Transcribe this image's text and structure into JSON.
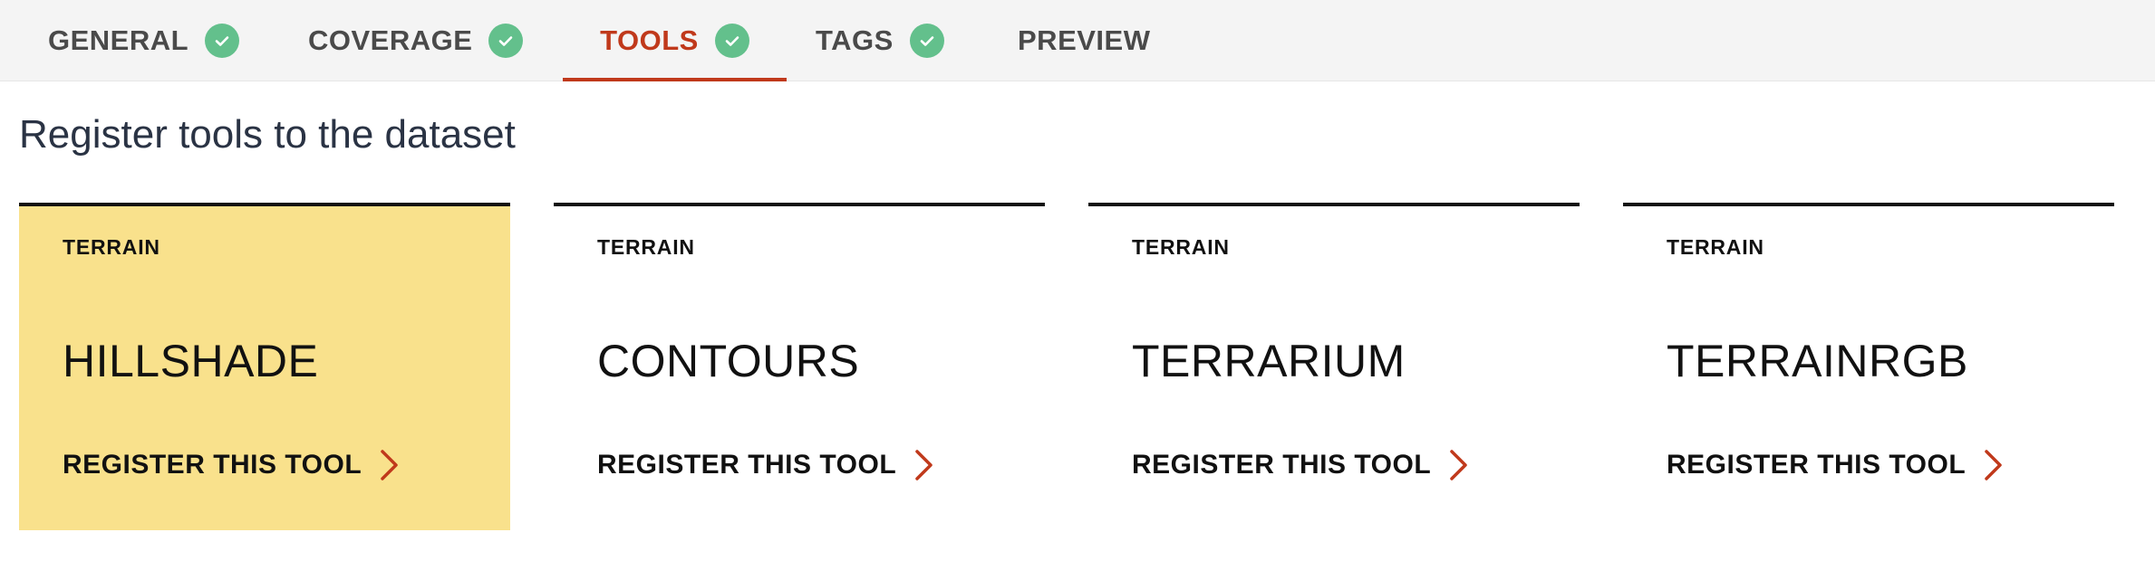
{
  "tabs": [
    {
      "label": "GENERAL",
      "completed": true,
      "active": false
    },
    {
      "label": "COVERAGE",
      "completed": true,
      "active": false
    },
    {
      "label": "TOOLS",
      "completed": true,
      "active": true
    },
    {
      "label": "TAGS",
      "completed": true,
      "active": false
    },
    {
      "label": "PREVIEW",
      "completed": false,
      "active": false
    }
  ],
  "heading": "Register tools to the dataset",
  "cards": [
    {
      "category": "TERRAIN",
      "name": "HILLSHADE",
      "action": "REGISTER THIS TOOL",
      "highlighted": true
    },
    {
      "category": "TERRAIN",
      "name": "CONTOURS",
      "action": "REGISTER THIS TOOL",
      "highlighted": false
    },
    {
      "category": "TERRAIN",
      "name": "TERRARIUM",
      "action": "REGISTER THIS TOOL",
      "highlighted": false
    },
    {
      "category": "TERRAIN",
      "name": "TERRAINRGB",
      "action": "REGISTER THIS TOOL",
      "highlighted": false
    }
  ],
  "icons": {
    "tab_status": "check-circle-icon",
    "card_action": "chevron-right-icon"
  },
  "colors": {
    "accent": "#c0391b",
    "success": "#63c08c",
    "highlight": "#f9e18c",
    "tab_bar": "#f4f4f4",
    "heading": "#2a3344"
  }
}
